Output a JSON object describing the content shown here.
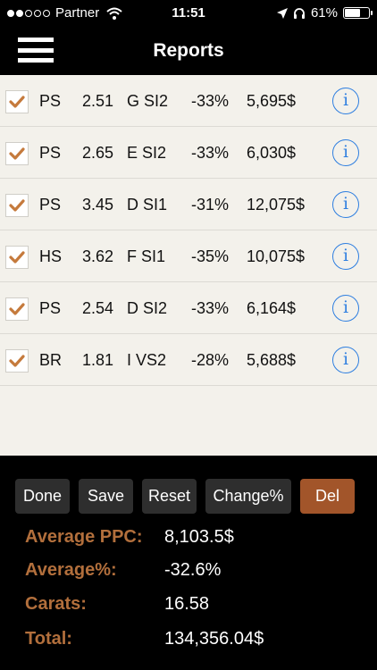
{
  "status_bar": {
    "carrier": "Partner",
    "time": "11:51",
    "battery": "61%",
    "battery_level": 0.61
  },
  "nav": {
    "title": "Reports"
  },
  "rows": [
    {
      "checked": true,
      "shape": "PS",
      "carat": "2.51",
      "grade": "G SI2",
      "percent": "-33%",
      "price": "5,695$"
    },
    {
      "checked": true,
      "shape": "PS",
      "carat": "2.65",
      "grade": "E SI2",
      "percent": "-33%",
      "price": "6,030$"
    },
    {
      "checked": true,
      "shape": "PS",
      "carat": "3.45",
      "grade": "D SI1",
      "percent": "-31%",
      "price": "12,075$"
    },
    {
      "checked": true,
      "shape": "HS",
      "carat": "3.62",
      "grade": "F SI1",
      "percent": "-35%",
      "price": "10,075$"
    },
    {
      "checked": true,
      "shape": "PS",
      "carat": "2.54",
      "grade": "D SI2",
      "percent": "-33%",
      "price": "6,164$"
    },
    {
      "checked": true,
      "shape": "BR",
      "carat": "1.81",
      "grade": "I VS2",
      "percent": "-28%",
      "price": "5,688$"
    }
  ],
  "info_icon_glyph": "i",
  "toolbar": {
    "done": "Done",
    "save": "Save",
    "reset": "Reset",
    "change_pct": "Change%",
    "del": "Del"
  },
  "stats": {
    "avg_ppc_label": "Average PPC:",
    "avg_ppc_value": "8,103.5$",
    "avg_pct_label": "Average%:",
    "avg_pct_value": "-32.6%",
    "carats_label": "Carats:",
    "carats_value": "16.58",
    "total_label": "Total:",
    "total_value": "134,356.04$"
  },
  "colors": {
    "accent": "#b26f3c",
    "delete": "#a2552a",
    "info": "#2f7fe0",
    "list_bg": "#f3f1eb"
  }
}
